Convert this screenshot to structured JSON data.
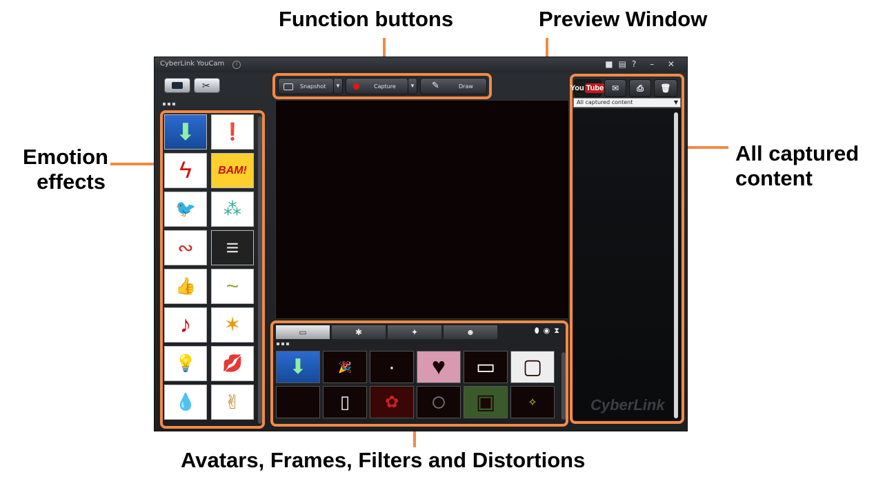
{
  "annotations": {
    "function_buttons": "Function buttons",
    "preview_window": "Preview Window",
    "emotion_effects_line1": "Emotion",
    "emotion_effects_line2": "effects",
    "captured_line1": "All captured",
    "captured_line2": "content",
    "bottom": "Avatars, Frames, Filters and Distortions"
  },
  "colors": {
    "callout_orange": "#f28a46",
    "selected_blue": "#2c6ad0"
  },
  "app": {
    "title": "CyberLink YouCam",
    "window_controls": "? – ✕",
    "watermark": "CyberLink"
  },
  "toolbar": {
    "snapshot": "Snapshot",
    "capture": "Capture",
    "draw": "Draw"
  },
  "share": {
    "youtube_you": "You",
    "youtube_tube": "Tube"
  },
  "captured_filter": {
    "selected": "All captured content"
  },
  "emotions": [
    {
      "icon": "green-down-arrow-icon",
      "glyph": "⬇"
    },
    {
      "icon": "exclamation-burst-icon",
      "glyph": "❗"
    },
    {
      "icon": "lightning-zigzag-icon",
      "glyph": "ϟ"
    },
    {
      "icon": "bam-burst-icon",
      "glyph": "BAM!"
    },
    {
      "icon": "crow-icon",
      "glyph": "🐦"
    },
    {
      "icon": "confetti-icon",
      "glyph": "⁂"
    },
    {
      "icon": "flying-lips-icon",
      "glyph": "∾"
    },
    {
      "icon": "static-lines-icon",
      "glyph": "≡"
    },
    {
      "icon": "thumbs-up-icon",
      "glyph": "👍"
    },
    {
      "icon": "blah-text-icon",
      "glyph": "~"
    },
    {
      "icon": "music-note-icon",
      "glyph": "♪"
    },
    {
      "icon": "sparks-icon",
      "glyph": "✶"
    },
    {
      "icon": "light-bulb-icon",
      "glyph": "💡"
    },
    {
      "icon": "red-lips-icon",
      "glyph": "💋"
    },
    {
      "icon": "water-drops-icon",
      "glyph": "💧"
    },
    {
      "icon": "victory-hand-icon",
      "glyph": "✌"
    }
  ],
  "tray_thumbs": [
    {
      "icon": "green-down-arrow-icon",
      "glyph": "⬇"
    },
    {
      "icon": "happy-birthday-frame-icon",
      "glyph": "🎉"
    },
    {
      "icon": "dots-frame-icon",
      "glyph": "·"
    },
    {
      "icon": "heart-frame-icon",
      "glyph": "♥"
    },
    {
      "icon": "photo-stack-frame-icon",
      "glyph": "▭"
    },
    {
      "icon": "ribbon-frame-icon",
      "glyph": "▢"
    },
    {
      "icon": "dark-frame-icon",
      "glyph": ""
    },
    {
      "icon": "paper-frame-icon",
      "glyph": "▯"
    },
    {
      "icon": "rose-frame-icon",
      "glyph": "✿"
    },
    {
      "icon": "circle-frame-icon",
      "glyph": "○"
    },
    {
      "icon": "green-frame-icon",
      "glyph": "▣"
    },
    {
      "icon": "sparkle-frame-icon",
      "glyph": "✧"
    }
  ]
}
